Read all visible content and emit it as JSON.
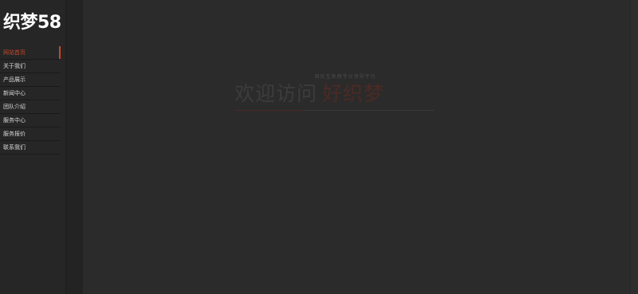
{
  "logo": {
    "text": "织梦58"
  },
  "nav": {
    "items": [
      {
        "label": "网站首页",
        "active": true
      },
      {
        "label": "关于我们",
        "active": false
      },
      {
        "label": "产品展示",
        "active": false
      },
      {
        "label": "新闻中心",
        "active": false
      },
      {
        "label": "团队介绍",
        "active": false
      },
      {
        "label": "服务中心",
        "active": false
      },
      {
        "label": "服务报价",
        "active": false
      },
      {
        "label": "联系我们",
        "active": false
      }
    ]
  },
  "welcome": {
    "subtitle": "国际互联网专业领导平台",
    "title_main": "欢迎访问",
    "title_accent": "好织梦"
  },
  "colors": {
    "accent": "#c8482a",
    "background": "#2b2b2b",
    "sidebar": "#262626"
  }
}
